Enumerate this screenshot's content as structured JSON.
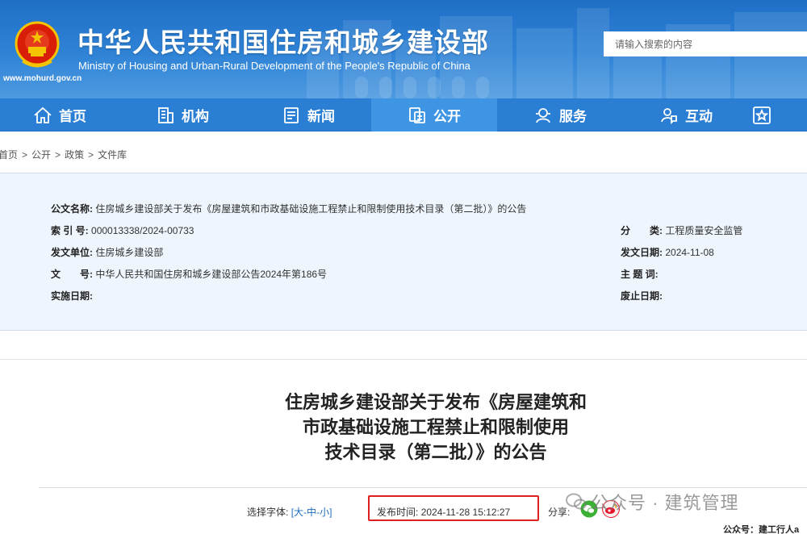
{
  "header": {
    "title": "中华人民共和国住房和城乡建设部",
    "subtitle": "Ministry of Housing and Urban-Rural Development of the People's Republic of China",
    "url": "www.mohurd.gov.cn",
    "search_placeholder": "请输入搜索的内容",
    "colors": {
      "header_blue": "#2a7fd4",
      "active_tab": "#3d95e4"
    }
  },
  "nav": {
    "items": [
      {
        "label": "首页",
        "icon": "home-icon"
      },
      {
        "label": "机构",
        "icon": "building-icon"
      },
      {
        "label": "新闻",
        "icon": "news-icon"
      },
      {
        "label": "公开",
        "icon": "document-icon",
        "active": true
      },
      {
        "label": "服务",
        "icon": "service-icon"
      },
      {
        "label": "互动",
        "icon": "interaction-icon"
      },
      {
        "label": "",
        "icon": "star-box-icon"
      }
    ]
  },
  "breadcrumb": [
    "首页",
    "公开",
    "政策",
    "文件库"
  ],
  "info": {
    "doc_name_label": "公文名称:",
    "doc_name": "住房城乡建设部关于发布《房屋建筑和市政基础设施工程禁止和限制使用技术目录（第二批）》的公告",
    "index_label": "索 引 号:",
    "index": "000013338/2024-00733",
    "category_label": "分　　类:",
    "category": "工程质量安全监管",
    "issuer_label": "发文单位:",
    "issuer": "住房城乡建设部",
    "issue_date_label": "发文日期:",
    "issue_date": "2024-11-08",
    "doc_no_label": "文　　号:",
    "doc_no": "中华人民共和国住房和城乡建设部公告2024年第186号",
    "keywords_label": "主 题 词:",
    "keywords": "",
    "effective_label": "实施日期:",
    "effective": "",
    "repeal_label": "废止日期:",
    "repeal": ""
  },
  "article": {
    "title_line1": "住房城乡建设部关于发布《房屋建筑和",
    "title_line2": "市政基础设施工程禁止和限制使用",
    "title_line3": "技术目录（第二批）》的公告",
    "font_label": "选择字体:",
    "font_open": "[",
    "font_large": "大",
    "font_dash1": "-",
    "font_medium": "中",
    "font_dash2": "-",
    "font_small": "小",
    "font_close": "]",
    "publish_time_label": "发布时间:",
    "publish_time": "2024-11-28 15:12:27",
    "share_label": "分享:",
    "highlight_color": "#e02020"
  },
  "overlay": {
    "watermark": "公众号 · 建筑管理",
    "credit": "公众号：建工行人a"
  }
}
